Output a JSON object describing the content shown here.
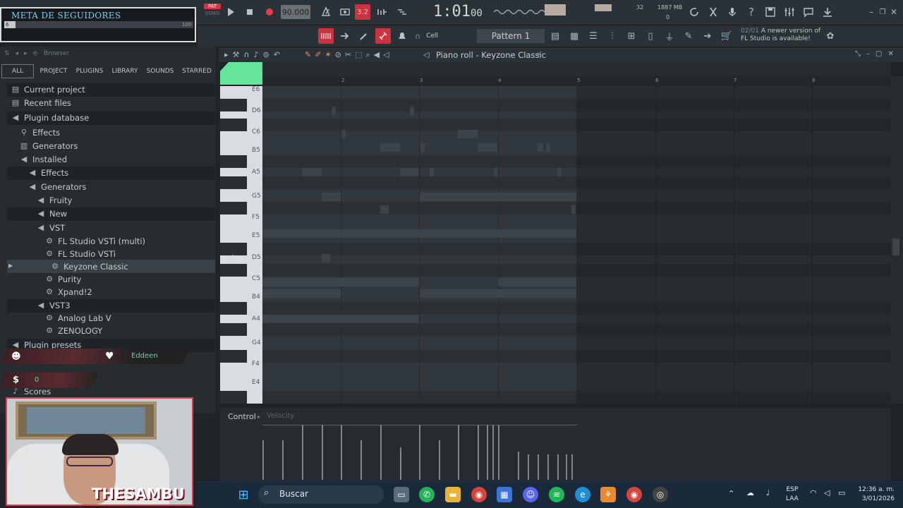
{
  "overlay": {
    "goal_title": "META DE SEGUIDORES",
    "goal_min": "6",
    "goal_max": "100",
    "goal_progress": 0.06,
    "chat_user": "Eddeen",
    "donation_amount": "0",
    "streamer_name": "THESAMBU"
  },
  "transport": {
    "pat_label": "PAT",
    "song_label": "SONG",
    "tempo": "90.000",
    "time": "1:01",
    "time_sub": "00",
    "cpu_value": "32",
    "memory": "1887 MB",
    "memory_sub": "0"
  },
  "toolbar2": {
    "snap": "Cell",
    "pattern": "Pattern 1",
    "update_notice_date": "02/01",
    "update_notice_text": "A newer version of",
    "update_notice_text2": "FL Studio is available!"
  },
  "browser": {
    "title": "Browser",
    "tabs": [
      "ALL",
      "PROJECT",
      "PLUGINS",
      "LIBRARY",
      "SOUNDS",
      "STARRED"
    ],
    "items": [
      {
        "label": "Current project",
        "icon": "folder-icon"
      },
      {
        "label": "Recent files",
        "icon": "folder-icon"
      },
      {
        "label": "Plugin database",
        "icon": "plug-icon"
      },
      {
        "label": "Effects",
        "icon": "fx-icon"
      },
      {
        "label": "Generators",
        "icon": "generator-icon"
      },
      {
        "label": "Installed",
        "icon": "plug-icon"
      },
      {
        "label": "Effects",
        "icon": "plug-icon"
      },
      {
        "label": "Generators",
        "icon": "plug-icon"
      },
      {
        "label": "Fruity",
        "icon": "plug-icon"
      },
      {
        "label": "New",
        "icon": "plug-icon"
      },
      {
        "label": "VST",
        "icon": "plug-icon"
      },
      {
        "label": "FL Studio VSTi (multi)",
        "icon": "gear-icon"
      },
      {
        "label": "FL Studio VSTi",
        "icon": "gear-icon"
      },
      {
        "label": "Keyzone Classic",
        "icon": "gear-icon"
      },
      {
        "label": "Purity",
        "icon": "gear-icon"
      },
      {
        "label": "Xpand!2",
        "icon": "gear-icon"
      },
      {
        "label": "VST3",
        "icon": "plug-icon"
      },
      {
        "label": "Analog Lab V",
        "icon": "gear-icon"
      },
      {
        "label": "ZENOLOGY",
        "icon": "gear-icon"
      },
      {
        "label": "Plugin presets",
        "icon": "plug-icon"
      },
      {
        "label": "Scores",
        "icon": "note-icon"
      }
    ]
  },
  "piano_roll": {
    "title": "Piano roll - Keyzone Classic",
    "bar_numbers": [
      "2",
      "3",
      "4",
      "5",
      "6",
      "7",
      "8"
    ],
    "key_labels": [
      "E6",
      "D6",
      "C6",
      "B5",
      "A5",
      "G5",
      "F5",
      "E5",
      "D5",
      "C5",
      "B4",
      "A4",
      "G4",
      "F4",
      "E4"
    ],
    "control_label": "Control",
    "control_target": "Velocity"
  },
  "taskbar": {
    "search": "Buscar",
    "language": "ESP",
    "language_sub": "LAA",
    "time": "12:36 a. m.",
    "date": "3/01/2026"
  }
}
